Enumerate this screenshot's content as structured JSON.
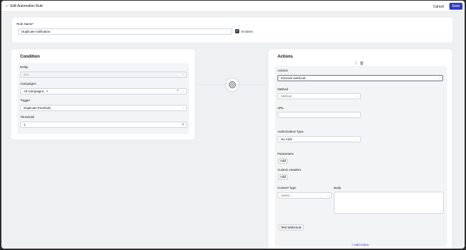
{
  "header": {
    "back_icon": "arrow-left-icon",
    "title": "Edit Automation Rule",
    "cancel": "Cancel",
    "save": "Save"
  },
  "rule": {
    "name_label": "Rule Name*",
    "name_value": "Duplicate notification",
    "enabled_label": "Enabled",
    "enabled": true
  },
  "condition": {
    "heading": "Condition",
    "entity_label": "Entity",
    "entity_value": "Ilike",
    "campaigns_label": "Campaigns",
    "campaigns_tag": "All Campaigns",
    "campaigns_tag_close": "×",
    "trigger_label": "Trigger",
    "trigger_value": "Duplicate threshold",
    "threshold_label": "Threshold",
    "threshold_value": "1"
  },
  "actions": {
    "heading": "Actions",
    "actions_label": "Actions",
    "actions_value": "Execute webhook",
    "method_label": "Method",
    "method_placeholder": "Method",
    "url_label": "URL",
    "url_value": "",
    "auth_label": "Authorization Type",
    "auth_value": "No Auth",
    "params_label": "Parameters",
    "params_add": "Add",
    "headers_label": "Custom Headers",
    "headers_add": "Add",
    "content_type_label": "Content Type",
    "content_type_placeholder": "Select...",
    "body_label": "Body",
    "test_button": "Test WebHook",
    "add_action": "+ Add Action"
  },
  "colors": {
    "accent": "#2f3ec2"
  }
}
